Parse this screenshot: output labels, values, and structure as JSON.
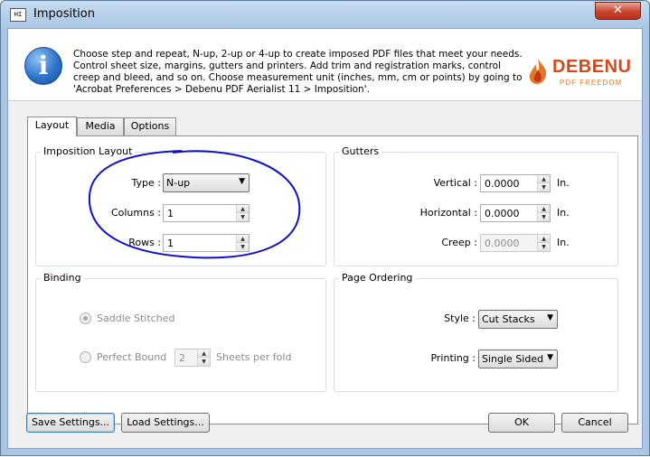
{
  "window": {
    "title": "Imposition",
    "app_icon_text": "HI",
    "close_glyph": "✕"
  },
  "header": {
    "description": "Choose step and repeat, N-up, 2-up or 4-up to create imposed PDF files that meet your needs. Control sheet size, margins, gutters and printers. Add trim and registration marks, control creep and bleed, and so on. Choose measurement unit (inches, mm, cm or points) by going to 'Acrobat Preferences > Debenu PDF Aerialist 11 > Imposition'.",
    "logo_name": "DEBENU",
    "logo_tagline": "PDF FREEDOM",
    "info_glyph": "i"
  },
  "tabs": [
    {
      "label": "Layout",
      "active": true
    },
    {
      "label": "Media",
      "active": false
    },
    {
      "label": "Options",
      "active": false
    }
  ],
  "imposition_layout": {
    "group_label": "Imposition Layout",
    "type_label": "Type :",
    "type_value": "N-up",
    "columns_label": "Columns :",
    "columns_value": "1",
    "rows_label": "Rows :",
    "rows_value": "1"
  },
  "gutters": {
    "group_label": "Gutters",
    "vertical_label": "Vertical :",
    "vertical_value": "0.0000",
    "horizontal_label": "Horizontal :",
    "horizontal_value": "0.0000",
    "creep_label": "Creep :",
    "creep_value": "0.0000",
    "unit": "In."
  },
  "binding": {
    "group_label": "Binding",
    "saddle_label": "Saddle Stitched",
    "perfect_label": "Perfect Bound",
    "sheets_value": "2",
    "sheets_label": "Sheets per fold"
  },
  "page_ordering": {
    "group_label": "Page Ordering",
    "style_label": "Style :",
    "style_value": "Cut Stacks",
    "printing_label": "Printing :",
    "printing_value": "Single Sided"
  },
  "footer": {
    "save_label": "Save Settings...",
    "load_label": "Load Settings...",
    "ok_label": "OK",
    "cancel_label": "Cancel"
  },
  "glyphs": {
    "up": "▲",
    "down": "▼"
  },
  "colors": {
    "annotation": "#1010c8",
    "logo": "#d24a1a"
  }
}
